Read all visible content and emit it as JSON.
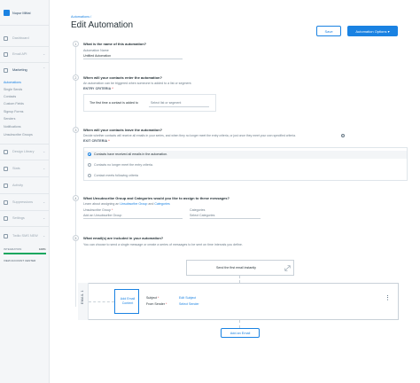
{
  "sidebar": {
    "user_name": "Nupur Mittal",
    "items": [
      {
        "label": "Dashboard",
        "icon": "dashboard-icon"
      },
      {
        "label": "Email API",
        "icon": "email-api-icon"
      },
      {
        "label": "Marketing",
        "icon": "marketing-icon"
      },
      {
        "label": "Design Library",
        "icon": "design-library-icon"
      },
      {
        "label": "Stats",
        "icon": "stats-icon"
      },
      {
        "label": "Activity",
        "icon": "activity-icon"
      },
      {
        "label": "Suppressions",
        "icon": "suppressions-icon"
      },
      {
        "label": "Settings",
        "icon": "settings-icon"
      },
      {
        "label": "Twilio SMS NEW",
        "icon": "twilio-sms-icon"
      }
    ],
    "marketing_subitems": [
      "Automations",
      "Single Sends",
      "Contacts",
      "Custom Fields",
      "Signup Forms",
      "Senders",
      "Notifications",
      "Unsubscribe Groups"
    ],
    "active_subitem_index": 0,
    "upgrade": {
      "label": "INTEGRATION",
      "percent_text": "100%",
      "percent": 100,
      "link": "VIEW ACCOUNT CENTER"
    }
  },
  "header": {
    "breadcrumb": "Automations  /",
    "title": "Edit Automation",
    "save_label": "Save",
    "options_label": "Automation Options  ▾"
  },
  "steps": {
    "s1": {
      "num": "1",
      "question": "What is the name of this automation?",
      "field_label": "Automation Name",
      "field_value": "Untitled Automation"
    },
    "s2": {
      "num": "2",
      "question": "When will your contacts enter the automation?",
      "description": "An automation can be triggered when someone is added to a list or segment.",
      "criteria_label": "ENTRY CRITERIA",
      "trigger_text": "The first time a contact is added to",
      "select_placeholder": "Select list or segment"
    },
    "s3": {
      "num": "3",
      "question": "When will your contacts leave the automation?",
      "description": "Decide whether contacts will receive all emails in your series, and when they no longer meet the entry criteria, or just once they meet your own specified criteria.",
      "criteria_label": "EXIT CRITERIA",
      "options": [
        "Contacts have received all emails in the automation.",
        "Contacts no longer meet the entry criteria.",
        "Contact meets following criteria"
      ],
      "selected_index": 0
    },
    "s4": {
      "num": "4",
      "question": "What Unsubscribe Group and Categories would you like to assign to these messages?",
      "learn_prefix": "Learn about assigning an",
      "learn_link1": "Unsubscribe Group",
      "learn_and": "and",
      "learn_link2": "Categories",
      "group_label": "Unsubscribe Group",
      "group_placeholder": "Add an Unsubscribe Group",
      "categories_label": "Categories",
      "categories_placeholder": "Select Categories"
    },
    "s5": {
      "num": "5",
      "question": "What email(s) are included in your automation?",
      "description": "You can choose to send a single message or create a series of messages to be sent on time intervals you define."
    }
  },
  "email_builder": {
    "send_first_label": "Send the first email instantly",
    "expand_icon": "expand-icon",
    "tab_label": "EMAIL 1",
    "add_content_label": "Add Email Content",
    "subject_label": "Subject",
    "subject_link": "Edit Subject",
    "from_label": "From Sender",
    "from_link": "Select Sender",
    "add_email_label": "Add an Email"
  },
  "colors": {
    "accent": "#1a82e2",
    "required": "#e0454b",
    "success": "#19a75f",
    "sidebar_bg": "#f4f6f8"
  }
}
